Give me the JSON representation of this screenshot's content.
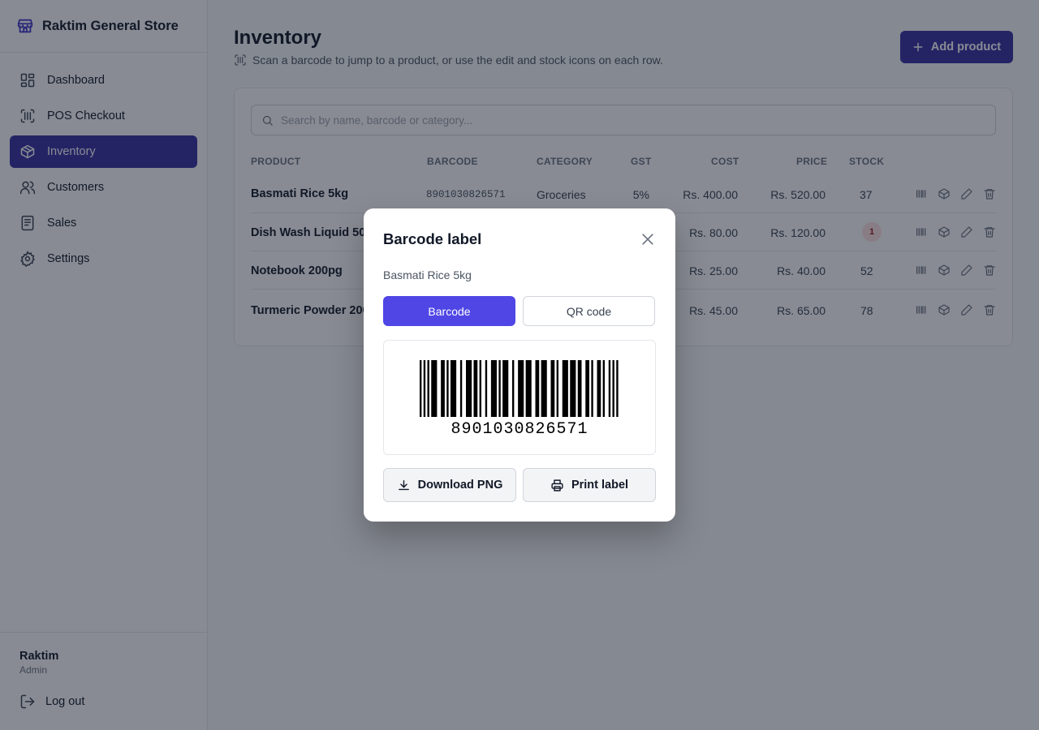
{
  "brand": {
    "name": "Raktim General Store"
  },
  "nav": [
    {
      "label": "Dashboard",
      "icon": "dashboard-icon",
      "active": false
    },
    {
      "label": "POS Checkout",
      "icon": "scan-icon",
      "active": false
    },
    {
      "label": "Inventory",
      "icon": "box-icon",
      "active": true
    },
    {
      "label": "Customers",
      "icon": "users-icon",
      "active": false
    },
    {
      "label": "Sales",
      "icon": "receipt-icon",
      "active": false
    },
    {
      "label": "Settings",
      "icon": "gear-icon",
      "active": false
    }
  ],
  "user": {
    "name": "Raktim",
    "role": "Admin",
    "logout_label": "Log out"
  },
  "page": {
    "title": "Inventory",
    "subtitle": "Scan a barcode to jump to a product, or use the edit and stock icons on each row.",
    "add_label": "Add product",
    "search_placeholder": "Search by name, barcode or category..."
  },
  "table": {
    "columns": [
      "PRODUCT",
      "BARCODE",
      "CATEGORY",
      "GST",
      "COST",
      "PRICE",
      "STOCK"
    ],
    "rows": [
      {
        "product": "Basmati Rice 5kg",
        "barcode": "8901030826571",
        "category": "Groceries",
        "gst": "5%",
        "cost": "Rs. 400.00",
        "price": "Rs. 520.00",
        "stock": "37",
        "low_stock": false
      },
      {
        "product": "Dish Wash Liquid 500",
        "barcode": "",
        "category": "",
        "gst": "",
        "cost": "Rs. 80.00",
        "price": "Rs. 120.00",
        "stock": "1",
        "low_stock": true
      },
      {
        "product": "Notebook 200pg",
        "barcode": "",
        "category": "",
        "gst": "",
        "cost": "Rs. 25.00",
        "price": "Rs. 40.00",
        "stock": "52",
        "low_stock": false
      },
      {
        "product": "Turmeric Powder 200",
        "barcode": "",
        "category": "",
        "gst": "",
        "cost": "Rs. 45.00",
        "price": "Rs. 65.00",
        "stock": "78",
        "low_stock": false
      }
    ]
  },
  "modal": {
    "title": "Barcode label",
    "product": "Basmati Rice 5kg",
    "tab_barcode": "Barcode",
    "tab_qr": "QR code",
    "barcode_value": "8901030826571",
    "download_label": "Download PNG",
    "print_label": "Print label"
  },
  "colors": {
    "accent": "#3730a3",
    "accent_button": "#4f46e5",
    "low_stock_bg": "#fee2e2"
  }
}
